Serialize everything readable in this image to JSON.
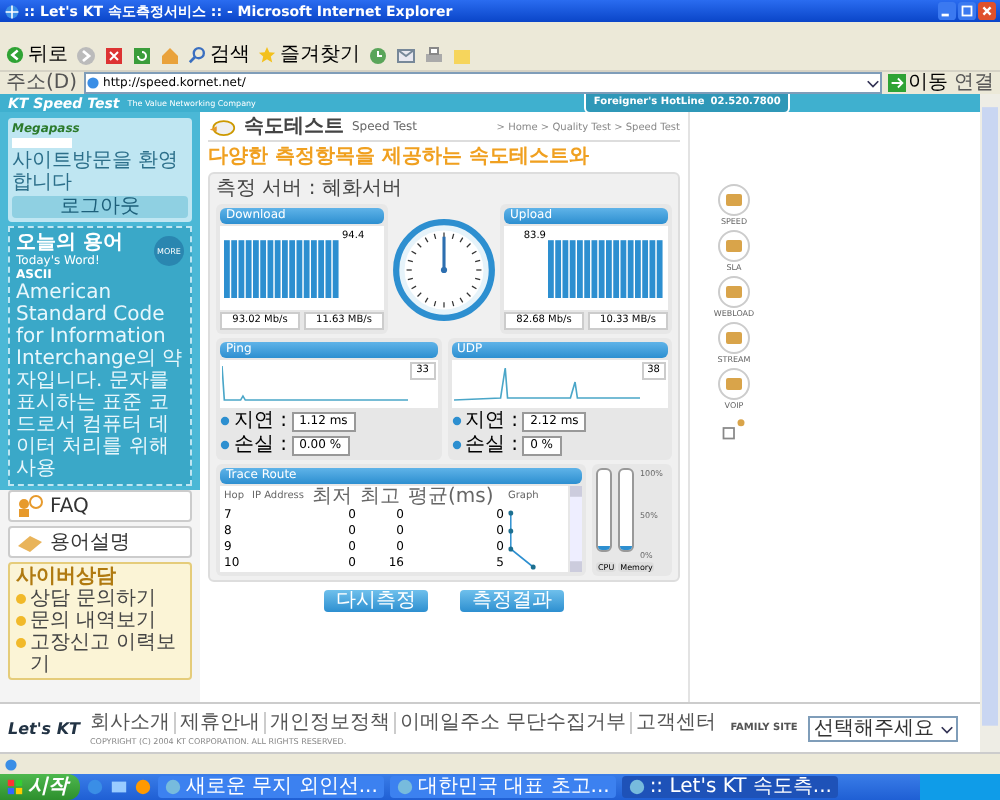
{
  "window": {
    "title": ":: Let's KT 속도측정서비스 :: - Microsoft Internet Explorer"
  },
  "toolbar": {
    "back": "뒤로",
    "search": "검색",
    "favorites": "즐겨찾기"
  },
  "address_bar": {
    "label": "주소(D)",
    "url": "http://speed.kornet.net/",
    "go": "이동",
    "links": "연결"
  },
  "header": {
    "logo": "KT Speed Test",
    "slogan": "The Value Networking Company",
    "hotline_title": "Foreigner's HotLine",
    "hotline_number": "02.520.7800"
  },
  "sidebar": {
    "brand": "Megapass",
    "welcome": "사이트방문을 환영합니다",
    "logout": "로그아웃",
    "word_title": "오늘의 용어",
    "word_subtitle": "Today's Word!",
    "more": "MORE",
    "term": "ASCII",
    "definition": "American Standard Code for Information Interchange의 약자입니다. 문자를 표시하는 표준 코드로서 컴퓨터 데이터 처리를 위해 사용",
    "faq": "FAQ",
    "glossary": "용어설명",
    "counsel_title": "사이버상담",
    "counsel_links": [
      "상담 문의하기",
      "문의 내역보기",
      "고장신고 이력보기"
    ]
  },
  "main": {
    "title": "속도테스트",
    "title_en": "Speed Test",
    "breadcrumb": "> Home > Quality Test > Speed Test",
    "headline": "다양한 측정항목을 제공하는 속도테스트와",
    "server": "측정 서버 : 혜화서버",
    "throughput": [
      {
        "name": "Download",
        "peak": "94.4",
        "readings": [
          "93.02 Mb/s",
          "11.63 MB/s"
        ]
      },
      {
        "name": "Upload",
        "peak": "83.9",
        "readings": [
          "82.68 Mb/s",
          "10.33 MB/s"
        ]
      }
    ],
    "latency": [
      {
        "name": "Ping",
        "value": "33",
        "delay_label": "지연 :",
        "delay": "1.12 ms",
        "loss_label": "손실 :",
        "loss": "0.00 %"
      },
      {
        "name": "UDP",
        "value": "38",
        "delay_label": "지연 :",
        "delay": "2.12 ms",
        "loss_label": "손실 :",
        "loss": "0 %"
      }
    ],
    "trace_route": {
      "title": "Trace Route",
      "columns": [
        "Hop",
        "IP Address",
        "최저",
        "최고",
        "평균(ms)",
        "Graph"
      ],
      "rows": [
        {
          "hop": "7",
          "min": "0",
          "max": "0",
          "avg": "0"
        },
        {
          "hop": "8",
          "min": "0",
          "max": "0",
          "avg": "0"
        },
        {
          "hop": "9",
          "min": "0",
          "max": "0",
          "avg": "0"
        },
        {
          "hop": "10",
          "min": "0",
          "max": "16",
          "avg": "5"
        }
      ]
    },
    "meter_scale": [
      "100%",
      "50%",
      "0%"
    ],
    "meters": [
      {
        "name": "CPU",
        "level": 0.05
      },
      {
        "name": "Memory",
        "level": 0.05
      }
    ],
    "buttons": [
      "다시측정",
      "측정결과"
    ]
  },
  "right_menu": [
    "SPEED",
    "SLA",
    "WEBLOAD",
    "STREAM",
    "VOIP"
  ],
  "footer": {
    "logo": "Let's KT",
    "links": [
      "회사소개",
      "제휴안내",
      "개인정보정책",
      "이메일주소 무단수집거부",
      "고객센터"
    ],
    "copyright": "COPYRIGHT (C) 2004 KT CORPORATION. ALL RIGHTS RESERVED.",
    "family_site": "FAMILY SITE",
    "family_select": "선택해주세요"
  },
  "taskbar": {
    "start": "시작",
    "tasks": [
      {
        "label": "새로운 무지 외인선...",
        "selected": false
      },
      {
        "label": "대한민국 대표 초고...",
        "selected": false
      },
      {
        "label": ":: Let's KT 속도측...",
        "selected": true
      }
    ]
  }
}
